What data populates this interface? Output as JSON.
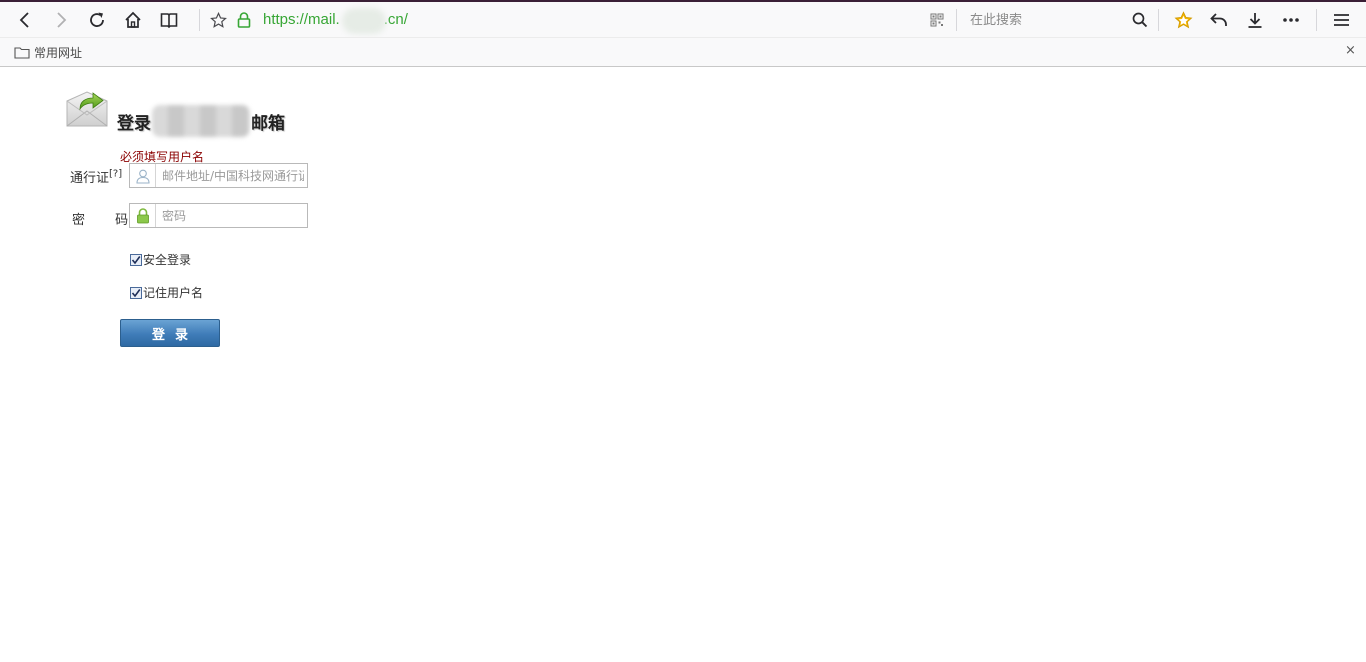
{
  "browser": {
    "url": "https://mail.",
    "url_suffix": ".cn/",
    "search_placeholder": "在此搜索",
    "bookmark_folder_label": "常用网址",
    "bookmark_close": "×"
  },
  "login": {
    "title_prefix": "登录",
    "title_suffix": "邮箱",
    "error_message": "必须填写用户名",
    "username_label": "通行证",
    "username_help": "[?]",
    "username_placeholder": "邮件地址/中国科技网通行证",
    "password_label": "密 码",
    "password_placeholder": "密码",
    "secure_login_label": "安全登录",
    "remember_username_label": "记住用户名",
    "login_button_label": "登录"
  },
  "colors": {
    "url_green": "#37a635",
    "star_gold": "#f4b400",
    "button_blue": "#3f7cb8"
  }
}
